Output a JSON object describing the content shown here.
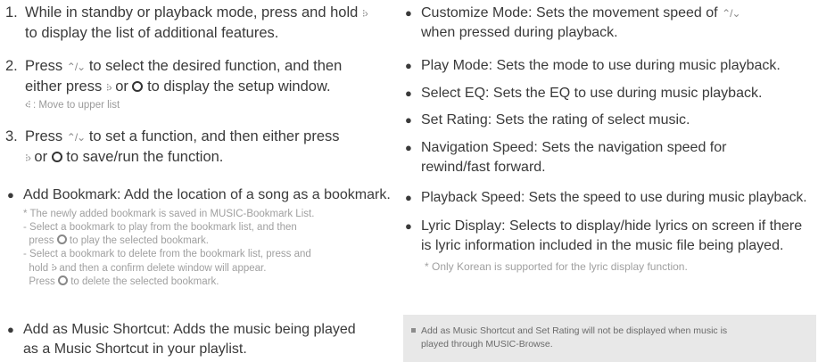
{
  "left": {
    "step1": {
      "num": "1.",
      "line1": "While in standby or playback mode, press and hold",
      "line2": "to display the list of additional features."
    },
    "step2": {
      "num": "2.",
      "line1a": "Press",
      "line1b": "to select the desired function, and then",
      "line2a": "either press",
      "line2b": "or",
      "line2c": "to display the setup window.",
      "sub": ": Move to upper list"
    },
    "step3": {
      "num": "3.",
      "line1a": "Press",
      "line1b": "to set a function, and then either press",
      "line2a": "or",
      "line2b": "to save/run the function."
    },
    "bookmark": {
      "text": "Add Bookmark: Add the location of a song as a bookmark.",
      "note1": "* The newly added bookmark is saved in MUSIC-Bookmark List.",
      "note2a": "- Select a bookmark to play from the bookmark list, and then",
      "note2b_pre": "press",
      "note2b_post": "to play the selected bookmark.",
      "note3a": "- Select a bookmark to delete from the bookmark list, press and",
      "note3b_pre": "hold",
      "note3b_post": "and then a confirm delete window will appear.",
      "note3c_pre": "Press",
      "note3c_post": "to delete the selected bookmark."
    },
    "shortcut": {
      "line1": "Add as Music Shortcut: Adds the music being played",
      "line2": "as a Music Shortcut in your playlist."
    }
  },
  "right": {
    "customize": {
      "line1a": "Customize Mode: Sets the movement speed of",
      "line2": "when pressed during playback."
    },
    "play_mode": "Play Mode: Sets the mode to use during music playback.",
    "select_eq": "Select EQ: Sets the EQ to use during music playback.",
    "set_rating": "Set Rating: Sets the rating of select music.",
    "nav_speed": {
      "line1": "Navigation Speed: Sets the navigation speed for",
      "line2": "rewind/fast forward."
    },
    "playback_speed": "Playback Speed: Sets the speed to use during music playback.",
    "lyric": {
      "line1": "Lyric Display: Selects to display/hide lyrics on screen if there",
      "line2": "is lyric information included in the music file being played.",
      "note": "* Only Korean is supported for the lyric display function."
    },
    "notebox": {
      "line1": "Add as Music Shortcut and Set Rating will not be displayed when music is",
      "line2": "played through MUSIC-Browse."
    }
  },
  "icons": {
    "right_key": "right-arrow-key-icon",
    "left_key": "left-arrow-key-icon",
    "up_down": "up-down-key-icon",
    "select": "select-button-icon"
  }
}
